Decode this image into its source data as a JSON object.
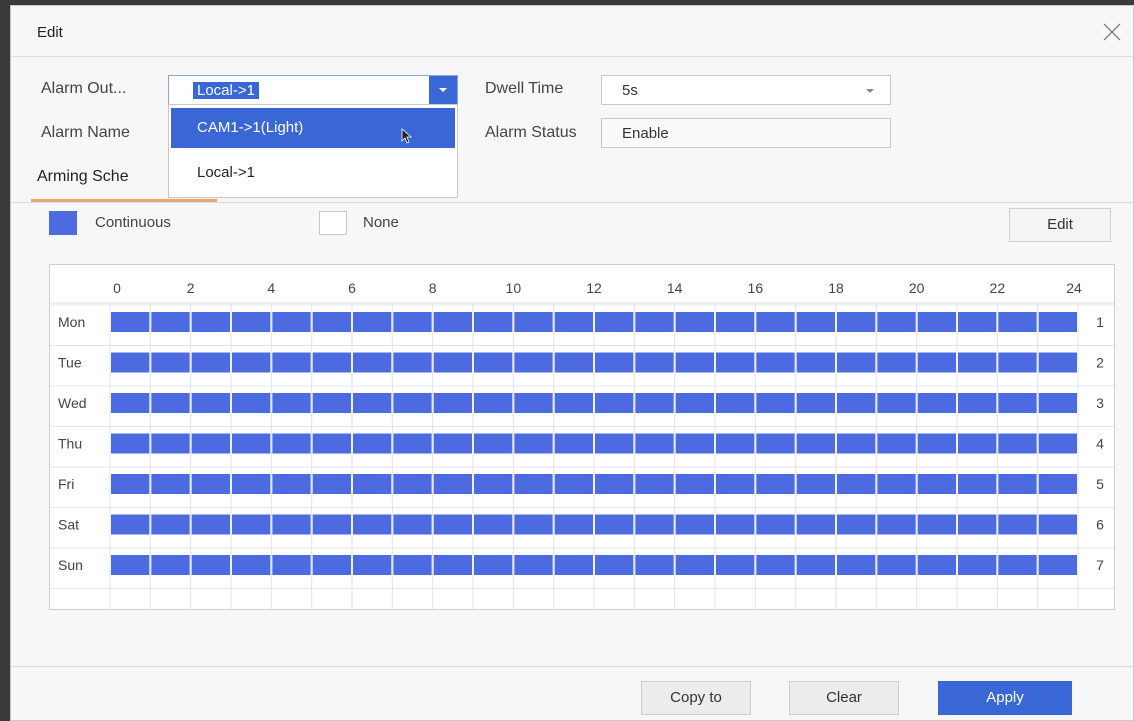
{
  "dialog": {
    "title": "Edit",
    "alarm_output_label": "Alarm Out...",
    "alarm_output_value": "Local->1",
    "alarm_output_options": [
      "CAM1->1(Light)",
      "Local->1"
    ],
    "alarm_name_label": "Alarm Name",
    "dwell_time_label": "Dwell Time",
    "dwell_time_value": "5s",
    "alarm_status_label": "Alarm Status",
    "alarm_status_value": "Enable",
    "tab_label": "Arming Sche",
    "legend_continuous": "Continuous",
    "legend_none": "None",
    "edit_button": "Edit",
    "copy_button": "Copy to",
    "clear_button": "Clear",
    "apply_button": "Apply"
  },
  "schedule": {
    "hours": [
      "0",
      "2",
      "4",
      "6",
      "8",
      "10",
      "12",
      "14",
      "16",
      "18",
      "20",
      "22",
      "24"
    ],
    "days": [
      {
        "label": "Mon",
        "index": "1"
      },
      {
        "label": "Tue",
        "index": "2"
      },
      {
        "label": "Wed",
        "index": "3"
      },
      {
        "label": "Thu",
        "index": "4"
      },
      {
        "label": "Fri",
        "index": "5"
      },
      {
        "label": "Sat",
        "index": "6"
      },
      {
        "label": "Sun",
        "index": "7"
      }
    ],
    "segments_per_day": 24,
    "armed_color": "#4d6be0",
    "mode": "Continuous"
  }
}
